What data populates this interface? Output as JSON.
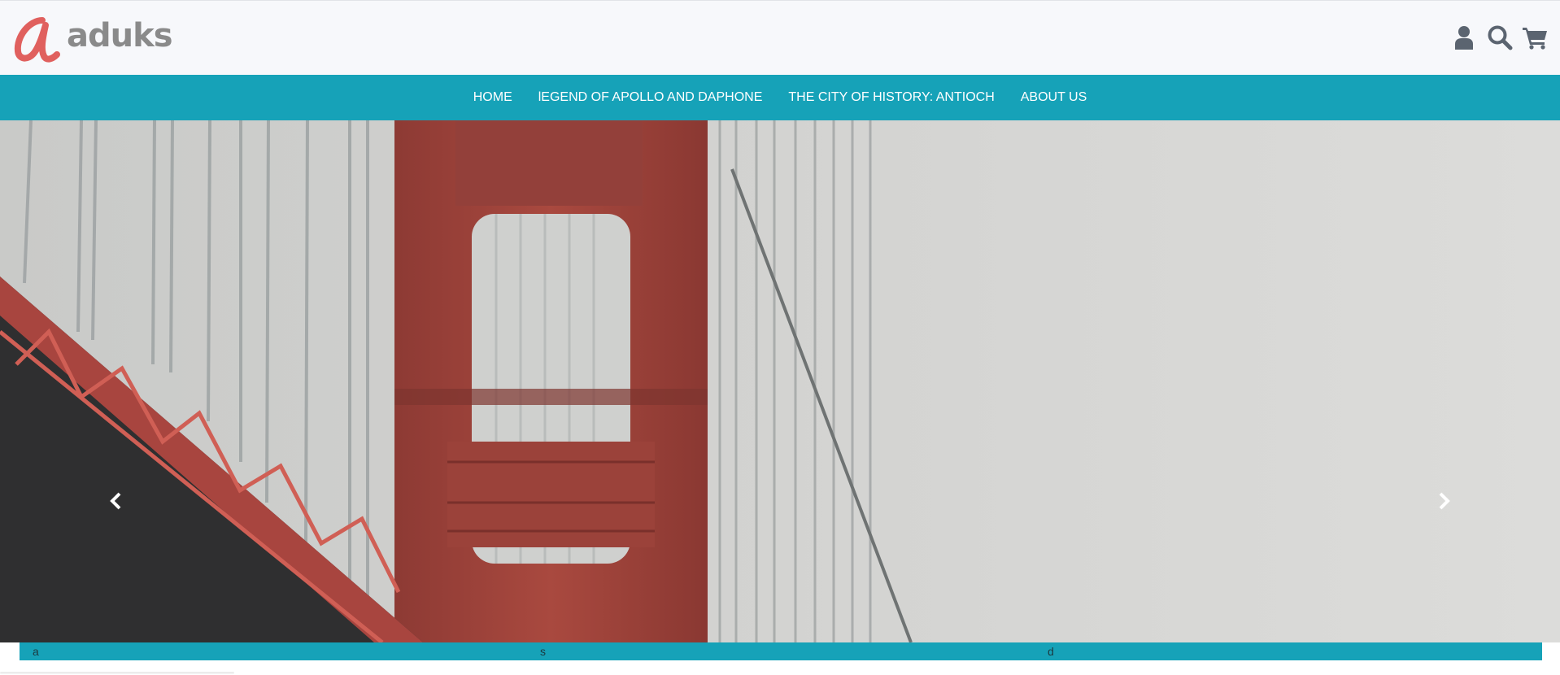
{
  "brand": {
    "name": "aduks",
    "mark_color": "#e0605e",
    "text_color": "#8a8a8a"
  },
  "header": {
    "icons": [
      "user-icon",
      "search-icon",
      "cart-icon"
    ],
    "icon_color": "#5b6470"
  },
  "nav": {
    "background": "#16a2b8",
    "items": [
      {
        "label": "HOME"
      },
      {
        "label": "lEGEND OF APOLLO AND DAPHONE"
      },
      {
        "label": "THE CITY OF HISTORY: ANTIOCH"
      },
      {
        "label": "ABOUT US"
      }
    ]
  },
  "carousel": {
    "slide_image": "golden-gate-bridge-tower-in-fog",
    "prev_icon": "chevron-left-icon",
    "next_icon": "chevron-right-icon"
  },
  "info_strip": {
    "cells": [
      "a",
      "s",
      "d"
    ]
  }
}
